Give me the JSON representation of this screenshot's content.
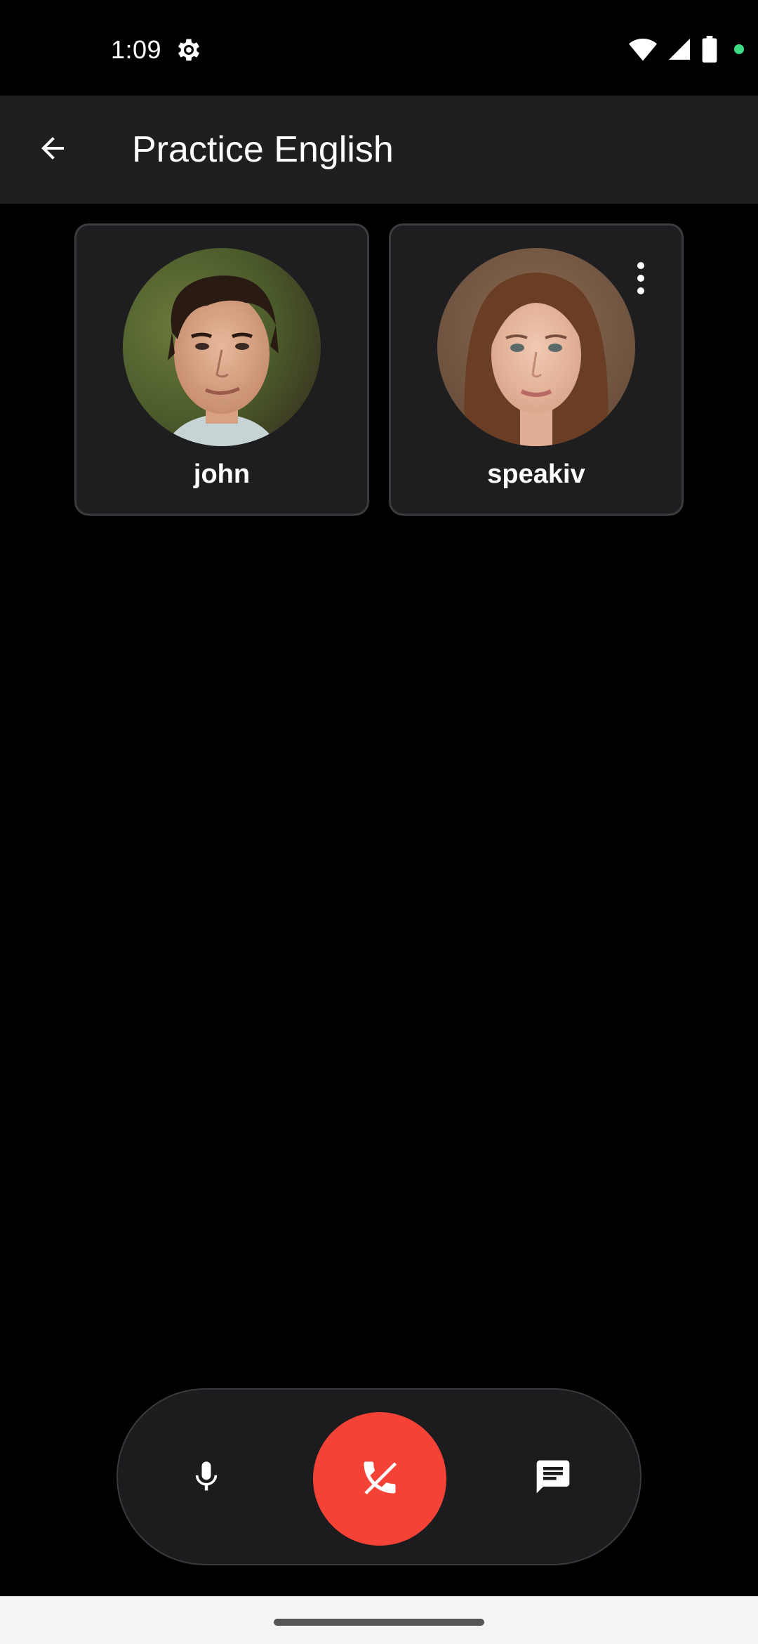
{
  "status_bar": {
    "time": "1:09",
    "icons": [
      "settings-gear-icon",
      "wifi-icon",
      "cellular-signal-icon",
      "battery-icon",
      "privacy-indicator-dot"
    ],
    "indicator_color": "#3ddc84"
  },
  "app_bar": {
    "back_icon": "arrow-back-icon",
    "title": "Practice English",
    "background": "#1f1f21"
  },
  "participants": [
    {
      "name": "john",
      "avatar": "male-portrait-photo"
    },
    {
      "name": "speakiv",
      "avatar": "female-portrait-photo",
      "menu_icon": "more-vert-icon"
    }
  ],
  "call_controls": {
    "mic_icon": "microphone-icon",
    "end_call_icon": "call-end-icon",
    "end_call_color": "#f44336",
    "chat_icon": "chat-message-icon"
  }
}
